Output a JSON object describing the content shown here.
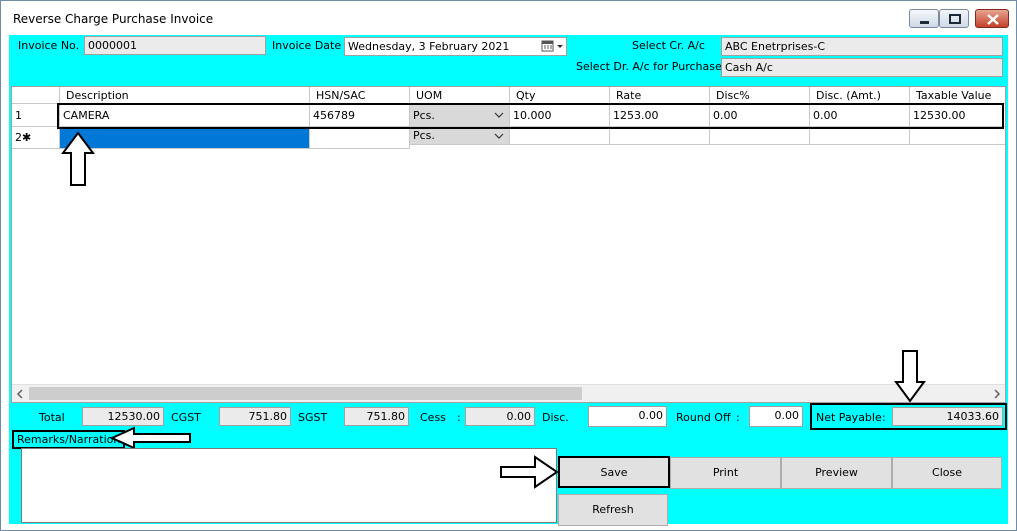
{
  "window": {
    "title": "Reverse Charge Purchase Invoice"
  },
  "header": {
    "invoice_no_label": "Invoice No. :",
    "invoice_no_value": "0000001",
    "invoice_date_label": "Invoice Date :",
    "invoice_date_value": "Wednesday,   3  February  2021",
    "select_cr_label": "Select Cr. A/c",
    "select_cr_value": "ABC Enetrprises-C",
    "select_dr_label": "Select Dr. A/c for Purchase",
    "select_dr_value": "Cash A/c"
  },
  "grid": {
    "columns": [
      "Description",
      "HSN/SAC",
      "UOM",
      "Qty",
      "Rate",
      "Disc%",
      "Disc. (Amt.)",
      "Taxable Value"
    ],
    "rows": [
      {
        "row_header": "1",
        "description": "CAMERA",
        "hsn_sac": "456789",
        "uom": "Pcs.",
        "qty": "10.000",
        "rate": "1253.00",
        "disc_pct": "0.00",
        "disc_amt": "0.00",
        "taxable_value": "12530.00"
      }
    ],
    "new_row": {
      "row_header": "2✱",
      "uom": "Pcs."
    }
  },
  "totals": {
    "total_label": "Total",
    "total_value": "12530.00",
    "cgst_label": "CGST",
    "cgst_value": "751.80",
    "sgst_label": "SGST",
    "sgst_value": "751.80",
    "cess_label": "Cess",
    "cess_colon": ":",
    "cess_value": "0.00",
    "disc_label": "Disc.",
    "disc_value": "0.00",
    "round_off_label": "Round Off",
    "round_off_colon": ":",
    "round_off_value": "0.00",
    "net_payable_label": "Net Payable",
    "net_payable_colon": ":",
    "net_payable_value": "14033.60"
  },
  "remarks": {
    "label": "Remarks/Narration",
    "value": ""
  },
  "buttons": {
    "save": "Save",
    "print": "Print",
    "preview": "Preview",
    "close": "Close",
    "refresh": "Refresh"
  },
  "icons": {
    "minimize": "minimize-icon",
    "maximize": "maximize-icon",
    "close": "close-icon",
    "calendar": "calendar-icon",
    "dropdown": "chevron-down-icon",
    "scroll_left": "scroll-left-icon",
    "scroll_right": "scroll-right-icon",
    "annotation_arrow": "arrow-annotation-icon"
  },
  "colors": {
    "client_background": "#00ffff",
    "selection": "#0078d7",
    "close_button": "#c5402a"
  }
}
